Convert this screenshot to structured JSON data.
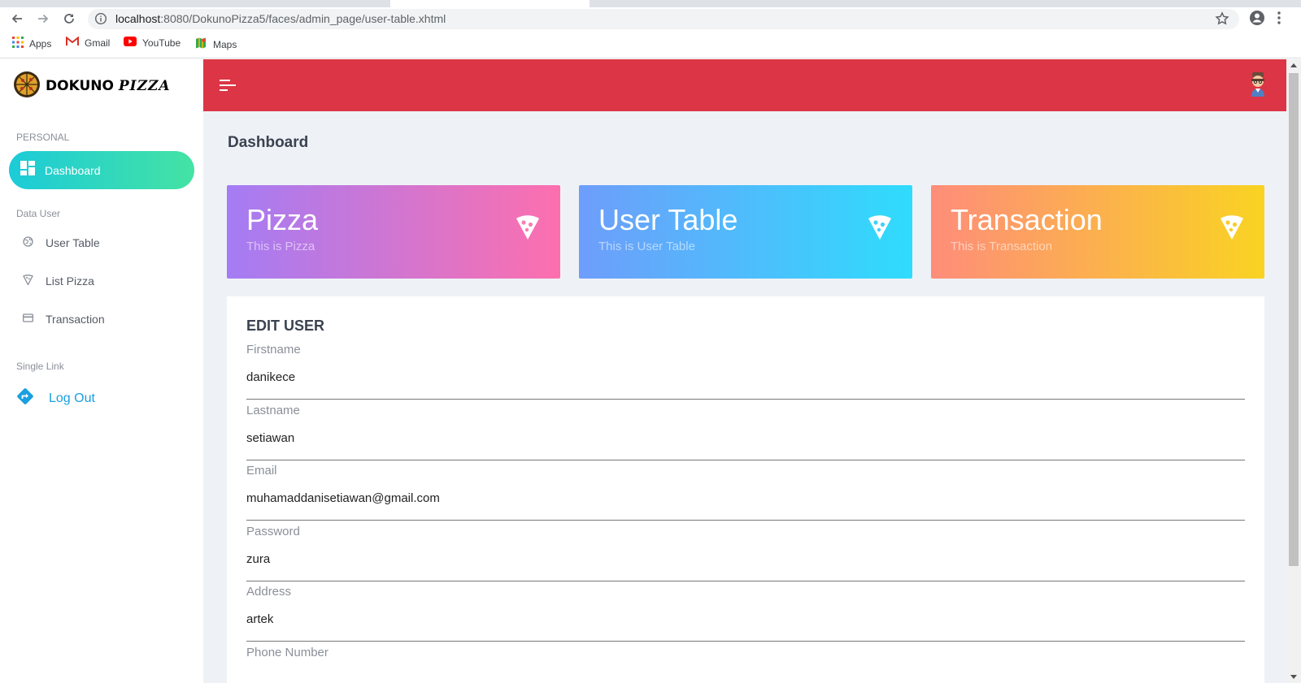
{
  "browser": {
    "url_host": "localhost",
    "url_rest": ":8080/DokunoPizza5/faces/admin_page/user-table.xhtml",
    "bookmarks": [
      {
        "label": "Apps",
        "icon": "apps-grid-icon"
      },
      {
        "label": "Gmail",
        "icon": "gmail-icon"
      },
      {
        "label": "YouTube",
        "icon": "youtube-icon"
      },
      {
        "label": "Maps",
        "icon": "maps-icon"
      }
    ]
  },
  "brand": {
    "name": "DOKUNO",
    "script": "PIZZA",
    "logo_icon": "pizza-logo-icon"
  },
  "sidebar": {
    "personal_label": "PERSONAL",
    "dashboard_label": "Dashboard",
    "data_user_label": "Data User",
    "items": [
      {
        "label": "User Table",
        "icon": "globe-icon"
      },
      {
        "label": "List Pizza",
        "icon": "pizza-slice-icon"
      },
      {
        "label": "Transaction",
        "icon": "card-icon"
      }
    ],
    "single_link_label": "Single Link",
    "logout_label": "Log Out"
  },
  "main": {
    "page_title": "Dashboard",
    "cards": [
      {
        "title": "Pizza",
        "subtitle": "This is Pizza"
      },
      {
        "title": "User Table",
        "subtitle": "This is User Table"
      },
      {
        "title": "Transaction",
        "subtitle": "This is Transaction"
      }
    ],
    "form": {
      "title": "EDIT USER",
      "fields": [
        {
          "label": "Firstname",
          "value": "danikece"
        },
        {
          "label": "Lastname",
          "value": "setiawan"
        },
        {
          "label": "Email",
          "value": "muhamaddanisetiawan@gmail.com"
        },
        {
          "label": "Password",
          "value": "zura"
        },
        {
          "label": "Address",
          "value": "artek"
        },
        {
          "label": "Phone Number",
          "value": ""
        }
      ]
    }
  },
  "colors": {
    "topbar": "#dc3545",
    "active_gradient_start": "#1ccbd8",
    "active_gradient_end": "#44e3a4",
    "logout": "#1a9fe0"
  }
}
